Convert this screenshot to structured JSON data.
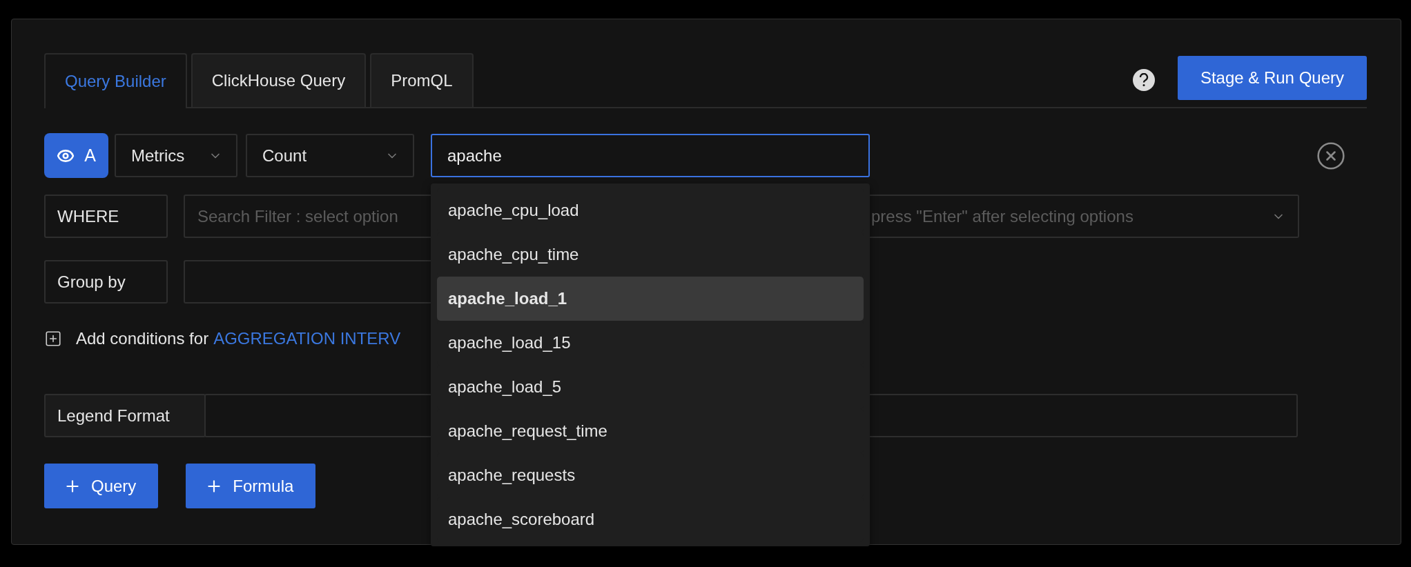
{
  "tabs": [
    {
      "label": "Query Builder",
      "selected": true
    },
    {
      "label": "ClickHouse Query",
      "selected": false
    },
    {
      "label": "PromQL",
      "selected": false
    }
  ],
  "run_button": "Stage & Run Query",
  "query": {
    "name": "A",
    "data_source": "Metrics",
    "aggregation": "Count",
    "metric_search": {
      "value": "apache"
    }
  },
  "suggestions": [
    {
      "label": "apache_cpu_load",
      "selected": false
    },
    {
      "label": "apache_cpu_time",
      "selected": false
    },
    {
      "label": "apache_load_1",
      "selected": true
    },
    {
      "label": "apache_load_15",
      "selected": false
    },
    {
      "label": "apache_load_5",
      "selected": false
    },
    {
      "label": "apache_request_time",
      "selected": false
    },
    {
      "label": "apache_requests",
      "selected": false
    },
    {
      "label": "apache_scoreboard",
      "selected": false
    }
  ],
  "where": {
    "label": "WHERE",
    "placeholder_start": "Search Filter : select option",
    "placeholder_end": "press \"Enter\" after selecting options"
  },
  "group_by": {
    "label": "Group by"
  },
  "conditions": {
    "text": "Add conditions for",
    "link": "AGGREGATION INTERV"
  },
  "legend": {
    "label": "Legend Format"
  },
  "add_buttons": [
    "Query",
    "Formula"
  ]
}
